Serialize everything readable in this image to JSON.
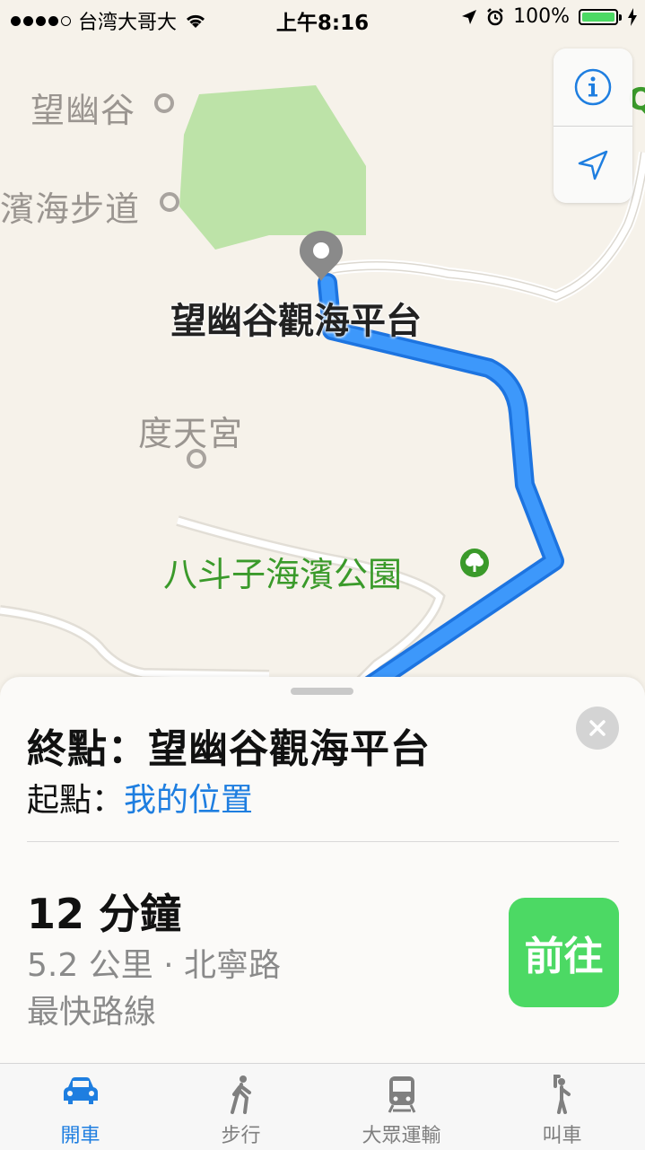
{
  "status_bar": {
    "carrier": "台湾大哥大",
    "time": "上午8:16",
    "battery": "100%"
  },
  "map": {
    "poi_wangyougu": "望幽谷",
    "poi_trail": "濱海步道",
    "poi_dutian": "度天宮",
    "park": "八斗子海濱公園",
    "destination_label": "望幽谷觀海平台",
    "route_color": "#2f8af5",
    "park_color": "#bde3a8"
  },
  "card": {
    "destination": "終點：望幽谷觀海平台",
    "origin_prefix": "起點：",
    "origin_value": "我的位置",
    "eta": "12 分鐘",
    "detail": "5.2 公里 · 北寧路",
    "route_type": "最快路線",
    "go_label": "前往"
  },
  "tabs": [
    {
      "label": "開車",
      "icon": "car-icon",
      "active": true
    },
    {
      "label": "步行",
      "icon": "walk-icon",
      "active": false
    },
    {
      "label": "大眾運輸",
      "icon": "train-icon",
      "active": false
    },
    {
      "label": "叫車",
      "icon": "ride-icon",
      "active": false
    }
  ]
}
